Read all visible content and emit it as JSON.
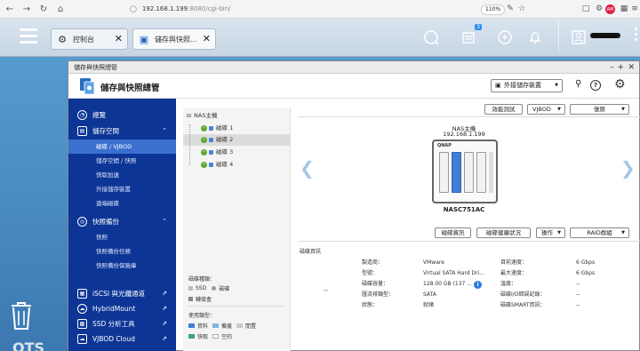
{
  "browser": {
    "url_host": "192.168.1.199",
    "url_rest": ":8080/cgi-bin/",
    "zoom": "110%"
  },
  "tabs": [
    {
      "label": "控制台"
    },
    {
      "label": "儲存與快照..."
    }
  ],
  "header": {
    "badge_count": "3"
  },
  "window": {
    "title": "儲存與快照總管",
    "app_title": "儲存與快照總管",
    "ext_storage_label": "外接儲存裝置"
  },
  "sidebar": {
    "overview": "總覽",
    "storage": "儲存空間",
    "storage_items": [
      "磁碟 / VJBOD",
      "儲存空間 / 快照",
      "快取加速",
      "外接儲存裝置",
      "遠端磁碟"
    ],
    "snapshot_backup": "快照備份",
    "snapshot_items": [
      "快照",
      "快照備份任務",
      "快照備份保險庫"
    ],
    "iscsi": "iSCSI 與光纖通道",
    "hybridmount": "HybridMount",
    "ssd": "SSD 分析工具",
    "vjbod": "VJBOD Cloud"
  },
  "tree": {
    "root": "NAS主機",
    "disks": [
      "磁碟 1",
      "磁碟 2",
      "磁碟 3",
      "磁碟 4"
    ],
    "disk_type_label": "磁碟種類：",
    "ssd": "SSD",
    "hdd": "磁碟",
    "enclosure": "轉接盒",
    "usage_label": "使用類型：",
    "data": "資料",
    "spare": "備援",
    "free": "閒置",
    "cache": "快取",
    "empty": "空的"
  },
  "toolbar": {
    "perf_test": "效能測試",
    "vjbod": "VJBOD",
    "restore": "復原"
  },
  "nas": {
    "title": "NAS主機",
    "ip": "192.168.1.199",
    "model": "NASC751AC",
    "brand": "QNAP"
  },
  "actions": {
    "disk_info": "磁碟資訊",
    "disk_health": "磁碟健康狀況",
    "operate": "操作",
    "raid_group": "RAID群組"
  },
  "info": {
    "section": "磁碟資訊",
    "dash": "--",
    "left": [
      [
        "製造商：",
        "VMware"
      ],
      [
        "型號：",
        "Virtual SATA Hard Dri..."
      ],
      [
        "磁碟容量：",
        "128.00 GB (137 ..."
      ],
      [
        "匯流排類型：",
        "SATA"
      ],
      [
        "狀態：",
        "就緒"
      ]
    ],
    "right": [
      [
        "目前速度：",
        "6 Gbps"
      ],
      [
        "最大速度：",
        "6 Gbps"
      ],
      [
        "溫度：",
        "--"
      ],
      [
        "磁碟I/O錯誤記錄：",
        "--"
      ],
      [
        "磁碟SMART資訊：",
        "--"
      ]
    ]
  },
  "colors": {
    "sidebar": "#0c3596",
    "selected": "#3b6fd0",
    "data": "#3f7fd6",
    "spare": "#7ab7e2",
    "free": "#c9c9c9",
    "cache": "#3aa28a",
    "ok": "#5ca72b"
  }
}
